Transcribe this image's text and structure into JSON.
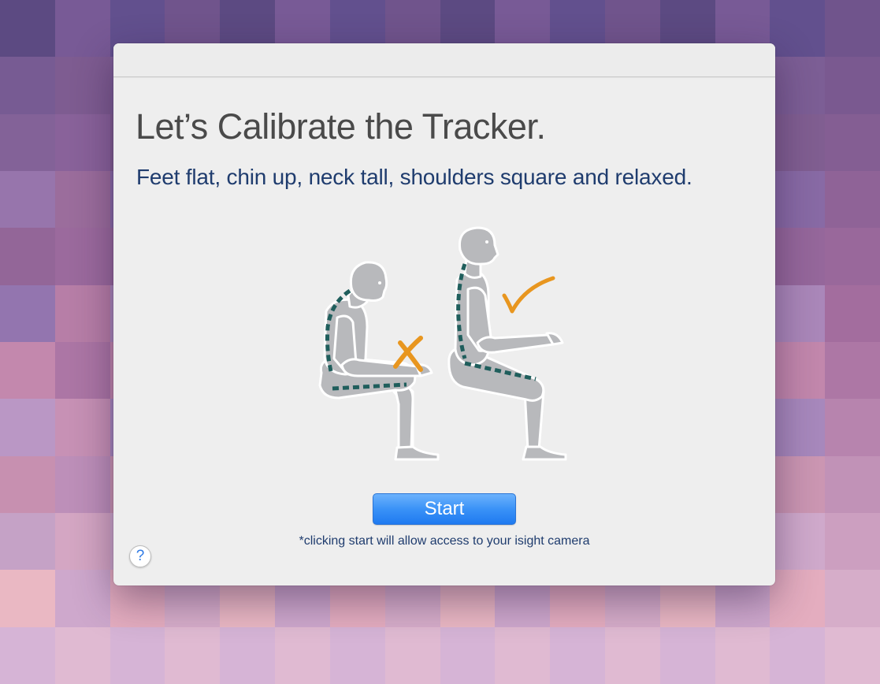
{
  "calibration": {
    "title": "Let’s Calibrate the Tracker.",
    "instructions": "Feet flat, chin up, neck tall, shoulders square and relaxed."
  },
  "illustration": {
    "figures": [
      {
        "posture": "slouched",
        "mark_icon": "cross-icon"
      },
      {
        "posture": "upright",
        "mark_icon": "check-icon"
      }
    ],
    "colors": {
      "body": "#b8b9bc",
      "body_outline": "#ffffff",
      "spine_line": "#1f5e5c",
      "mark": "#e8961f"
    }
  },
  "actions": {
    "start_label": "Start",
    "camera_note": "*clicking start will allow access to your isight camera",
    "help_label": "?"
  },
  "theme": {
    "accent": "#2f86f4",
    "heading_color": "#4a4a4a",
    "text_color": "#1f3c6e",
    "window_bg": "#eeeeee"
  }
}
